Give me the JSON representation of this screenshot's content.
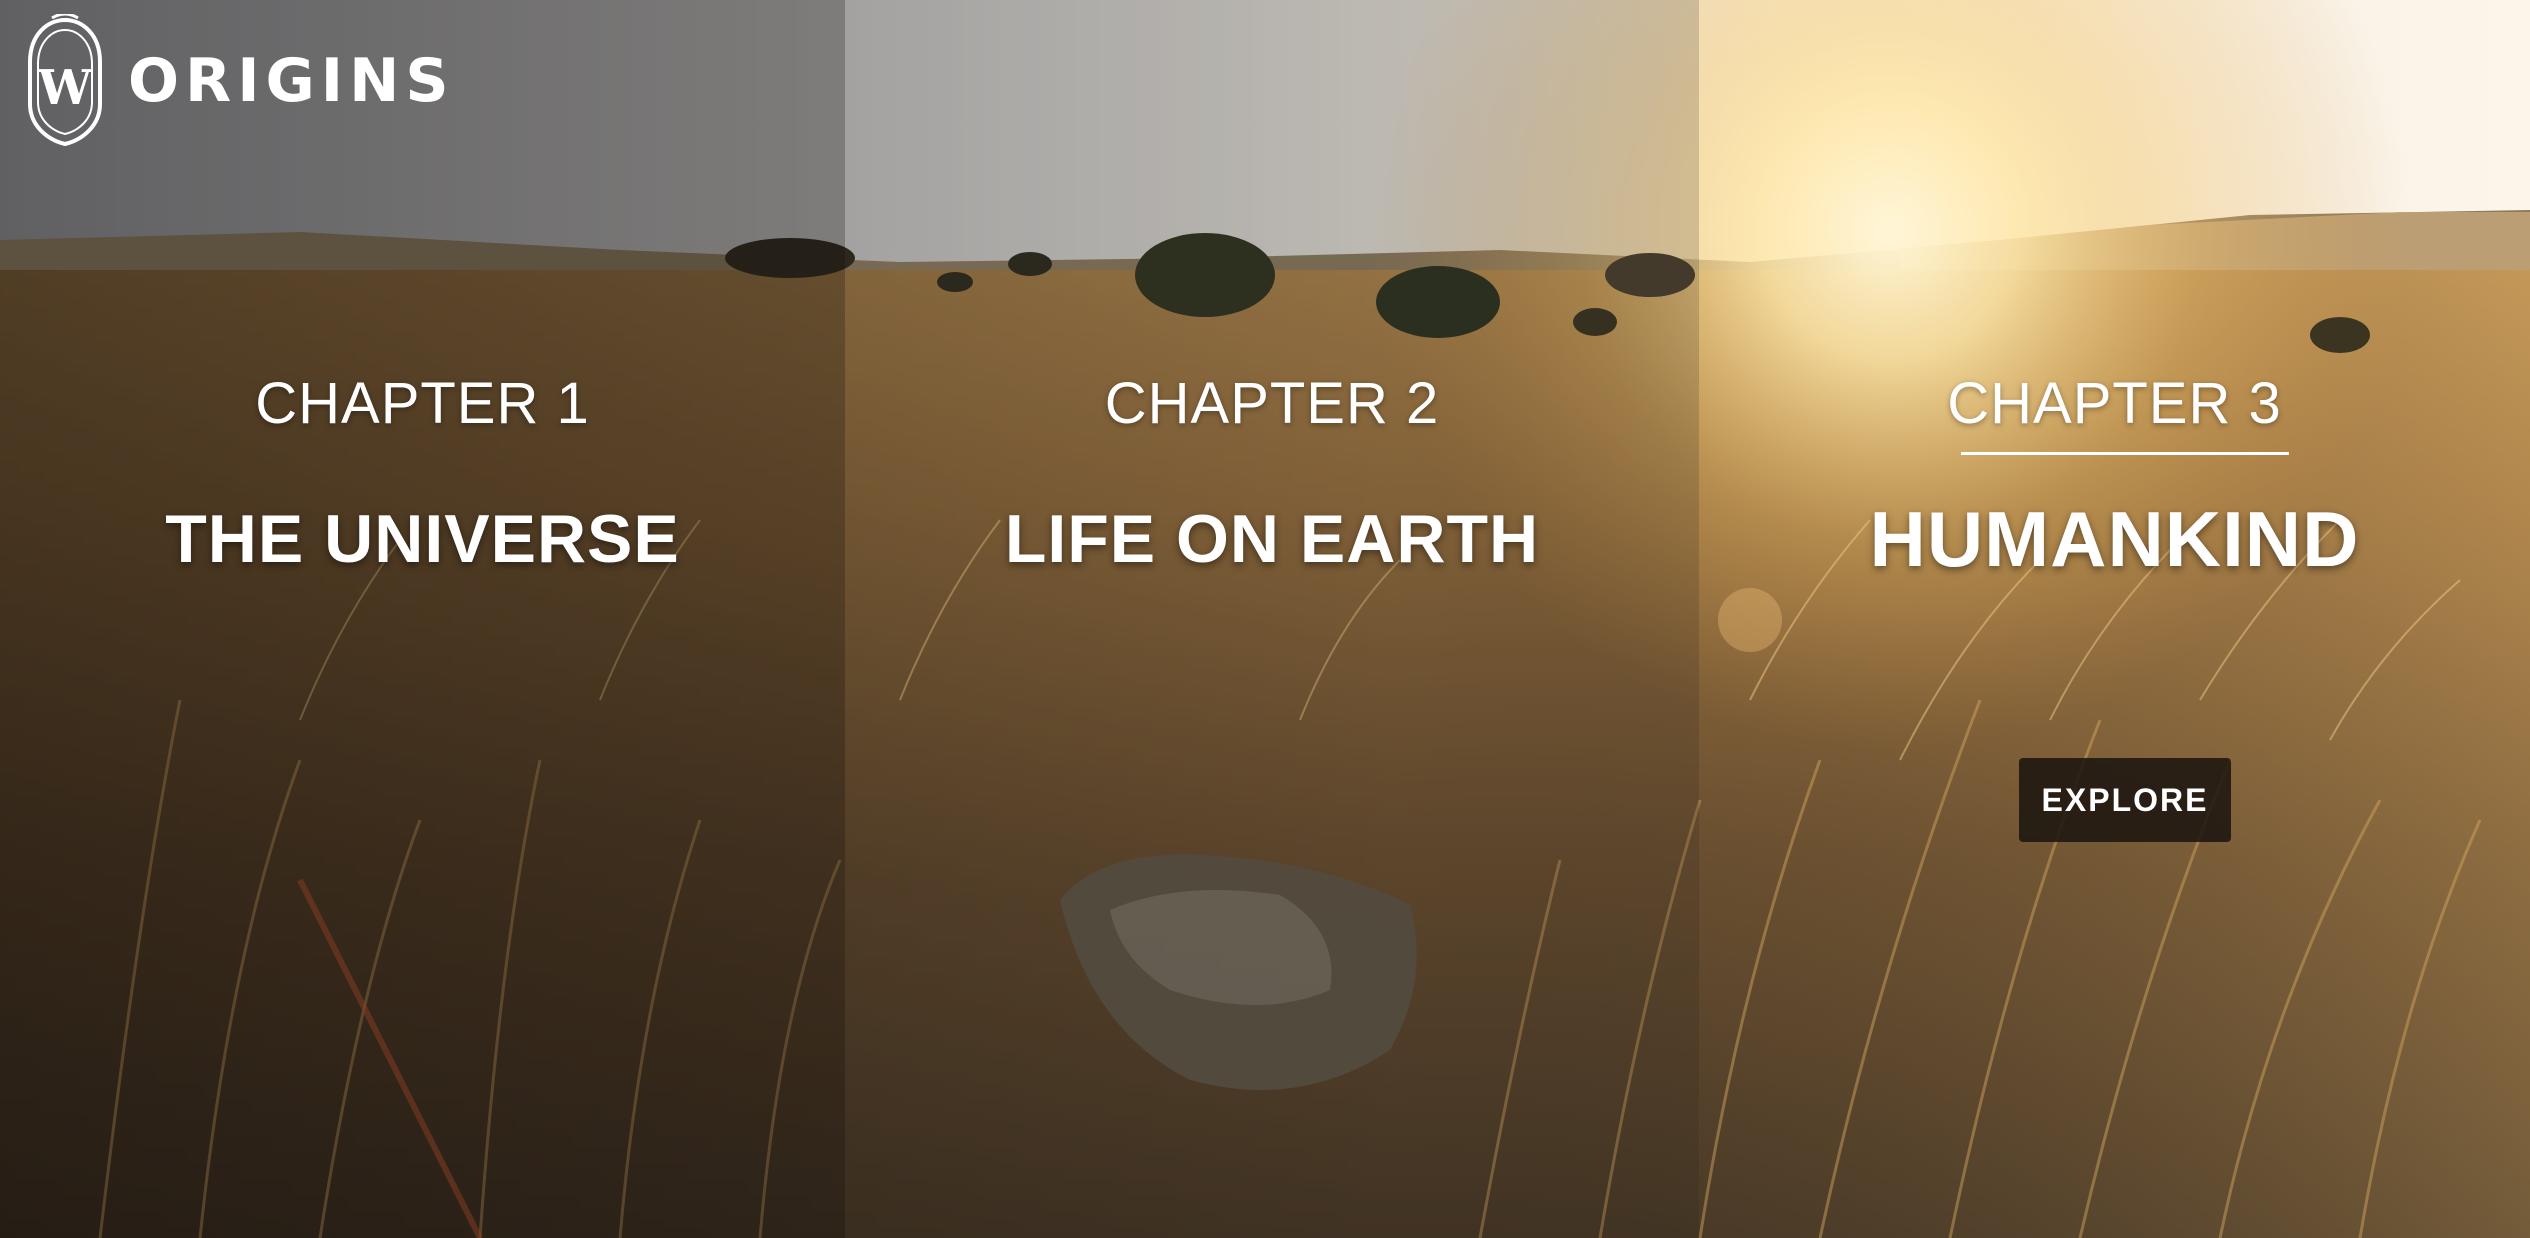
{
  "site": {
    "title": "ORIGINS",
    "crest_letter": "W"
  },
  "chapters": [
    {
      "label": "CHAPTER 1",
      "title": "THE UNIVERSE"
    },
    {
      "label": "CHAPTER 2",
      "title": "LIFE ON EARTH"
    },
    {
      "label": "CHAPTER 3",
      "title": "HUMANKIND",
      "button": "EXPLORE"
    }
  ],
  "colors": {
    "text": "#ffffff",
    "button_bg": "#1c1610",
    "grass": "#b8874a",
    "sky_left": "#6f7278",
    "sky_right": "#fff4dc"
  }
}
